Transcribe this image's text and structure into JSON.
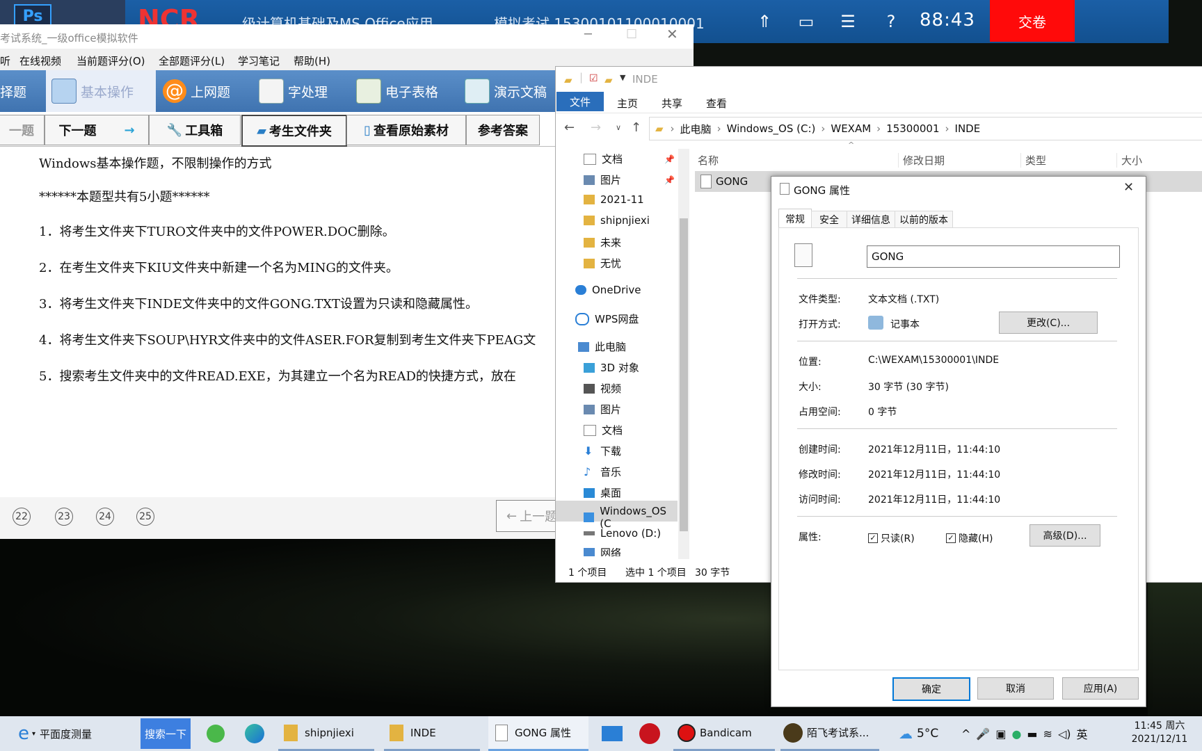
{
  "banner": {
    "title_text": "级计算机基础及MS Office应用",
    "exam_text": "模拟考试 15300101100010001",
    "timer": "88:43",
    "submit_label": "交卷",
    "ps_label": "Ps"
  },
  "exam": {
    "window_title": "考试系统_一级office模拟软件",
    "menu": [
      "听",
      "在线视频",
      "当前题评分(O)",
      "全部题评分(L)",
      "学习笔记",
      "帮助(H)"
    ],
    "modules": [
      "择题",
      "基本操作",
      "上网题",
      "字处理",
      "电子表格",
      "演示文稿"
    ],
    "toolbar": {
      "prev": "一题",
      "next": "下一题",
      "tools": "工具箱",
      "folder": "考生文件夹",
      "original": "查看原始素材",
      "answer": "参考答案"
    },
    "questions": {
      "header": "Windows基本操作题，不限制操作的方式",
      "count": "******本题型共有5小题******",
      "q1": "1．将考生文件夹下TURO文件夹中的文件POWER.DOC删除。",
      "q2": "2．在考生文件夹下KIU文件夹中新建一个名为MING的文件夹。",
      "q3": "3．将考生文件夹下INDE文件夹中的文件GONG.TXT设置为只读和隐藏属性。",
      "q4": "4．将考生文件夹下SOUP\\HYR文件夹中的文件ASER.FOR复制到考生文件夹下PEAG文",
      "q5": "5．搜索考生文件夹中的文件READ.EXE，为其建立一个名为READ的快捷方式，放在"
    },
    "qnums": [
      "22",
      "23",
      "24",
      "25"
    ],
    "prev_page": "上一题"
  },
  "explorer": {
    "title": "INDE",
    "ribbon": {
      "file": "文件",
      "home": "主页",
      "share": "共享",
      "view": "查看"
    },
    "path": [
      "此电脑",
      "Windows_OS (C:)",
      "WEXAM",
      "15300001",
      "INDE"
    ],
    "nav": {
      "n1": "文档",
      "n2": "图片",
      "n3": "2021-11",
      "n4": "shipnjiexi",
      "n5": "未来",
      "n6": "无忧",
      "n7": "OneDrive",
      "n8": "WPS网盘",
      "n9": "此电脑",
      "n10": "3D 对象",
      "n11": "视频",
      "n12": "图片",
      "n13": "文档",
      "n14": "下载",
      "n15": "音乐",
      "n16": "桌面",
      "n17": "Windows_OS (C",
      "n18": "Lenovo (D:)",
      "n19": "网络"
    },
    "columns": {
      "name": "名称",
      "date": "修改日期",
      "type": "类型",
      "size": "大小"
    },
    "file_name": "GONG",
    "status": {
      "count": "1 个项目",
      "selected": "选中 1 个项目",
      "size": "30 字节"
    }
  },
  "props": {
    "title": "GONG 属性",
    "tabs": [
      "常规",
      "安全",
      "详细信息",
      "以前的版本"
    ],
    "name_value": "GONG",
    "rows": {
      "type_l": "文件类型:",
      "type_v": "文本文档 (.TXT)",
      "open_l": "打开方式:",
      "open_v": "记事本",
      "change": "更改(C)...",
      "loc_l": "位置:",
      "loc_v": "C:\\WEXAM\\15300001\\INDE",
      "size_l": "大小:",
      "size_v": "30 字节 (30 字节)",
      "disk_l": "占用空间:",
      "disk_v": "0 字节",
      "created_l": "创建时间:",
      "created_v": "2021年12月11日，11:44:10",
      "mod_l": "修改时间:",
      "mod_v": "2021年12月11日，11:44:10",
      "acc_l": "访问时间:",
      "acc_v": "2021年12月11日，11:44:10",
      "attr_l": "属性:",
      "readonly": "只读(R)",
      "hidden": "隐藏(H)",
      "advanced": "高级(D)..."
    },
    "ok": "确定",
    "cancel": "取消",
    "apply": "应用(A)"
  },
  "taskbar": {
    "baidu": "平面度测量",
    "search": "搜索一下",
    "shipnjiexi": "shipnjiexi",
    "inde": "INDE",
    "gong": "GONG 属性",
    "bandicam": "Bandicam",
    "exam": "陌飞考试系...",
    "temp": "5°C",
    "lang": "英",
    "time": "11:45 周六",
    "date": "2021/12/11"
  },
  "colors": {
    "accent": "#2a6ebb",
    "banner": "#1b5fa6",
    "submit": "#ff0a0a"
  }
}
